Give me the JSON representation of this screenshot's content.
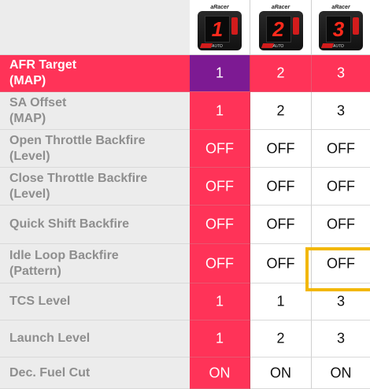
{
  "devices": [
    {
      "brand": "aRacer",
      "digit": "1",
      "sub": "AUTO"
    },
    {
      "brand": "aRacer",
      "digit": "2",
      "sub": "AUTO"
    },
    {
      "brand": "aRacer",
      "digit": "3",
      "sub": "AUTO"
    }
  ],
  "rows": [
    {
      "label": "AFR Target\n(MAP)",
      "values": [
        "1",
        "2",
        "3"
      ]
    },
    {
      "label": "SA Offset\n(MAP)",
      "values": [
        "1",
        "2",
        "3"
      ]
    },
    {
      "label": "Open Throttle Backfire\n(Level)",
      "values": [
        "OFF",
        "OFF",
        "OFF"
      ]
    },
    {
      "label": "Close Throttle Backfire\n(Level)",
      "values": [
        "OFF",
        "OFF",
        "OFF"
      ]
    },
    {
      "label": "Quick Shift Backfire",
      "values": [
        "OFF",
        "OFF",
        "OFF"
      ]
    },
    {
      "label": "Idle Loop Backfire\n(Pattern)",
      "values": [
        "OFF",
        "OFF",
        "OFF"
      ]
    },
    {
      "label": "TCS Level",
      "values": [
        "1",
        "1",
        "3"
      ]
    },
    {
      "label": "Launch Level",
      "values": [
        "1",
        "2",
        "3"
      ]
    },
    {
      "label": "Dec. Fuel Cut",
      "values": [
        "ON",
        "ON",
        "ON"
      ]
    }
  ],
  "colors": {
    "accent": "#ff3358",
    "selected": "#7d1a93",
    "highlight_box": "#f2b705"
  }
}
